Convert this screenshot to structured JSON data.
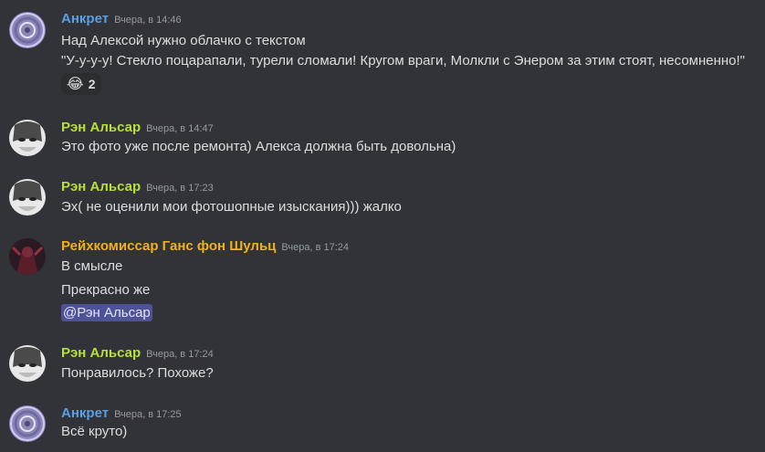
{
  "messages": [
    {
      "author": "Анкрет",
      "color": "#5aa0e6",
      "timestamp": "Вчера, в 14:46",
      "lines": [
        "Над Алексой нужно облачко с текстом",
        "\"У-у-у-у! Стекло поцарапали, турели сломали! Кругом враги, Молкли с Энером за этим стоят, несомненно!\""
      ],
      "reaction": {
        "emoji": "😂",
        "count": "2"
      }
    },
    {
      "author": "Рэн Альсар",
      "color": "#b8e03a",
      "timestamp": "Вчера, в 14:47",
      "lines": [
        "Это фото уже после ремонта) Алекса должна быть довольна)"
      ]
    },
    {
      "author": "Рэн Альсар",
      "color": "#b8e03a",
      "timestamp": "Вчера, в 17:23",
      "lines": [
        "Эх( не оценили мои фотошопные изыскания))) жалко"
      ]
    },
    {
      "author": "Рейхкомиссар Ганс фон Шульц",
      "color": "#f0b21a",
      "timestamp": "Вчера, в 17:24",
      "lines": [
        "В смысле",
        "Прекрасно же"
      ],
      "mention": "@Рэн Альсар"
    },
    {
      "author": "Рэн Альсар",
      "color": "#b8e03a",
      "timestamp": "Вчера, в 17:24",
      "lines": [
        "Понравилось? Похоже?"
      ]
    },
    {
      "author": "Анкрет",
      "color": "#5aa0e6",
      "timestamp": "Вчера, в 17:25",
      "lines": [
        "Всё круто)"
      ]
    }
  ]
}
